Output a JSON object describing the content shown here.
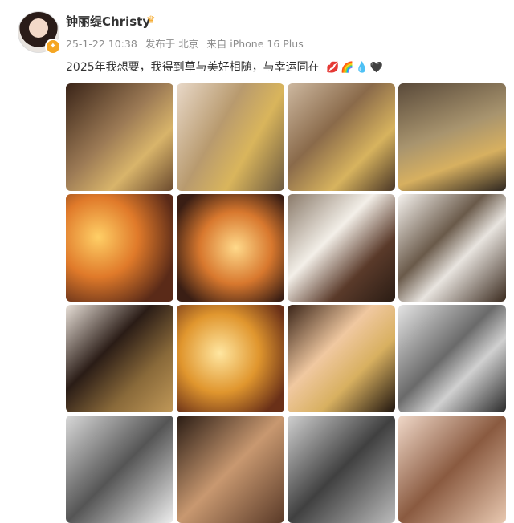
{
  "post": {
    "author": "钟丽缇Christy",
    "date": "25-1-22 10:38",
    "published_at": "发布于 北京",
    "source": "来自 iPhone 16 Plus",
    "text": "2025年我想要，我得到草与美好相随，与幸运同在",
    "emoji": "💋🌈💧🖤"
  },
  "photos": [
    {
      "label": "couple-photo-1"
    },
    {
      "label": "couple-photo-2"
    },
    {
      "label": "couple-photo-3"
    },
    {
      "label": "couple-photo-4"
    },
    {
      "label": "couple-photo-5"
    },
    {
      "label": "portrait-photo-6"
    },
    {
      "label": "dog-photo-7"
    },
    {
      "label": "dog-photo-8"
    },
    {
      "label": "portrait-photo-9"
    },
    {
      "label": "portrait-photo-10"
    },
    {
      "label": "portrait-photo-11"
    },
    {
      "label": "portrait-photo-12"
    },
    {
      "label": "portrait-photo-13"
    },
    {
      "label": "portrait-photo-14"
    },
    {
      "label": "portrait-photo-15"
    },
    {
      "label": "portrait-photo-16"
    }
  ]
}
